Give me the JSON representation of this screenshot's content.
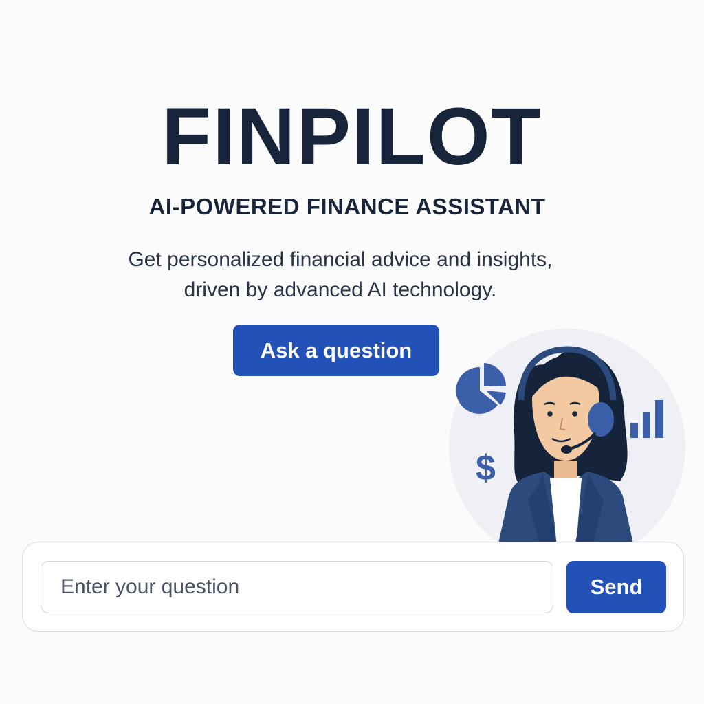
{
  "hero": {
    "title": "FINPILOT",
    "subtitle": "AI-POWERED FINANCE ASSISTANT",
    "description_line1": "Get personalized financial advice and insights,",
    "description_line2": "driven by advanced AI technology.",
    "ask_button_label": "Ask a question"
  },
  "illustration": {
    "icons": [
      "pie-chart-icon",
      "bar-chart-icon",
      "dollar-icon",
      "headset-agent"
    ],
    "dollar_symbol": "$"
  },
  "question_bar": {
    "input_placeholder": "Enter your question",
    "input_value": "",
    "send_label": "Send"
  },
  "colors": {
    "accent": "#2252b8",
    "title": "#17243a",
    "illustration_blue": "#3b5fa8",
    "jacket": "#2d4a7c",
    "hair": "#15243a",
    "skin": "#f2c9a0",
    "backdrop_circle": "#eef0f5"
  }
}
